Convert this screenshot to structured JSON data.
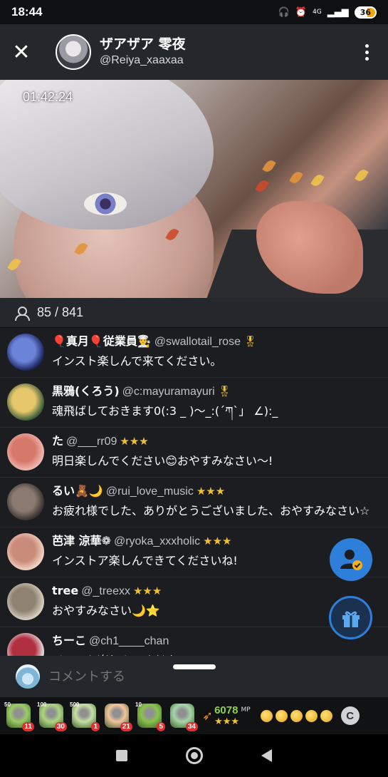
{
  "status_bar": {
    "time": "18:44",
    "network": "4G",
    "battery": "36"
  },
  "header": {
    "close_icon": "close-icon",
    "host_name": "ザアザア 零夜",
    "host_handle": "@Reiya_xaaxaa",
    "more_icon": "more-vertical-icon"
  },
  "video": {
    "elapsed": "01:42:24"
  },
  "viewers": {
    "icon": "person-icon",
    "count": "85 / 841"
  },
  "comments": [
    {
      "name": "🎈真月🎈従業員👨‍🍳",
      "handle": "@swallotail_rose",
      "badge": "🎖",
      "text": "インスト楽しんで来てください。",
      "avatar_colors": [
        "#1e2560",
        "#6b84d8"
      ]
    },
    {
      "name": "黒鴉(くろう)",
      "handle": "@c:mayuramayuri",
      "badge": "🎖",
      "text": "魂飛ばしておきます0(:3 _ )～_:(´ཀ`」 ∠):_",
      "avatar_colors": [
        "#3a5d3b",
        "#e6c76c"
      ]
    },
    {
      "name": "た",
      "handle": "@___rr09",
      "badge": "★★★",
      "text": "明日楽しんでください😊おやすみなさい〜!",
      "avatar_colors": [
        "#f0b8b0",
        "#d6786a"
      ]
    },
    {
      "name": "るい🧸🌙",
      "handle": "@rui_love_music",
      "badge": "★★★",
      "text": "お疲れ様でした、ありがとうございました、おやすみなさい☆",
      "avatar_colors": [
        "#3a3330",
        "#8a7a70"
      ]
    },
    {
      "name": "芭津 涼華❁",
      "handle": "@ryoka_xxxholic",
      "badge": "★★★",
      "text": "インストア楽しんできてくださいね!",
      "avatar_colors": [
        "#f3d2c4",
        "#c98b7a"
      ]
    },
    {
      "name": "tree",
      "handle": "@_treexx",
      "badge": "★★★",
      "text": "おやすみなさい🌙⭐",
      "avatar_colors": [
        "#d7cfc1",
        "#8f8270"
      ]
    },
    {
      "name": "ちーこ",
      "handle": "@ch1____chan",
      "badge": "",
      "text": "インスト楽しんでください",
      "avatar_colors": [
        "#e8e0e4",
        "#b03040"
      ]
    }
  ],
  "fab": {
    "profile_icon": "user-check-icon",
    "gift_icon": "gift-icon"
  },
  "input": {
    "placeholder": "コメントする"
  },
  "gift_tray": {
    "gifts": [
      {
        "tag": "50",
        "count": "11",
        "color": "#9ccc65"
      },
      {
        "tag": "100",
        "count": "30",
        "color": "#aed581"
      },
      {
        "tag": "500",
        "count": "1",
        "color": "#c5e1a5"
      },
      {
        "tag": "",
        "count": "21",
        "color": "#f2c49b"
      },
      {
        "tag": "10",
        "count": "5",
        "color": "#8bc34a"
      },
      {
        "tag": "",
        "count": "34",
        "color": "#a5d6a7"
      }
    ],
    "mp_value": "6078",
    "mp_unit": "MP",
    "mp_stars": "★★★",
    "coin_count": 5,
    "c_label": "C"
  },
  "nav": {
    "recents": "recents-icon",
    "home": "home-icon",
    "back": "back-icon"
  }
}
